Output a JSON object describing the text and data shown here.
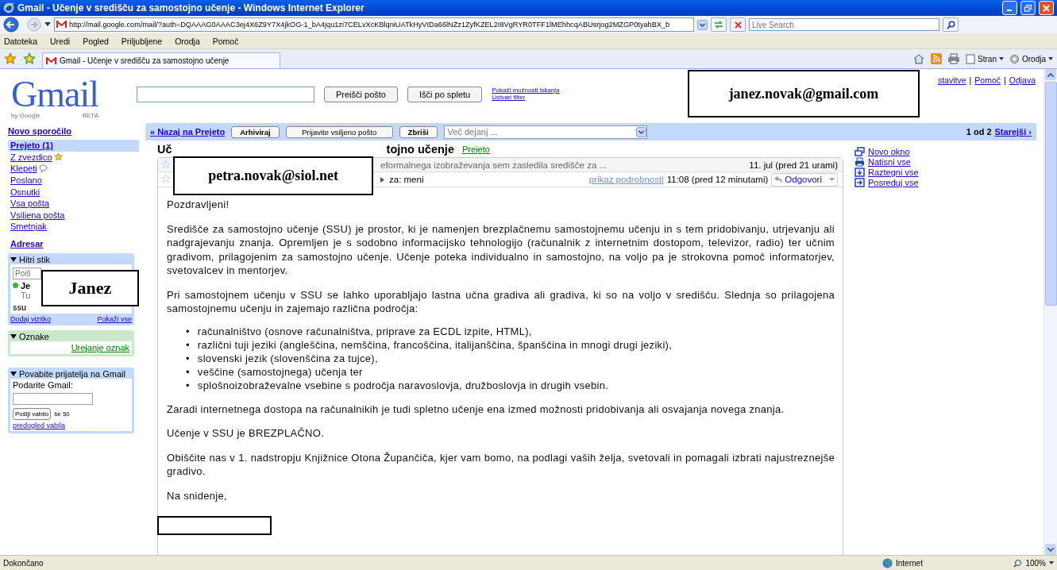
{
  "window": {
    "title": "Gmail - Učenje v središču za samostojno učenje - Windows Internet Explorer"
  },
  "address_bar": {
    "url": "http://mail.google.com/mail/?auth=DQAAAG0AAAC3ej4X6Z9Y7X4jkOG-1_bA4jqu1zi7CELvXcKBlqniUATkHyVIDa66lNZz1ZyfKZEL2I8VgRYR0TFF1lMEhhcqABUsrjog2MZGP0tyahBX_b",
    "search_placeholder": "Live Search"
  },
  "menu": [
    "Datoteka",
    "Uredi",
    "Pogled",
    "Priljubljene",
    "Orodja",
    "Pomoč"
  ],
  "tab": {
    "title": "Gmail - Učenje v središču za samostojno učenje"
  },
  "command_bar": [
    {
      "kind": "page",
      "label": "Stran"
    },
    {
      "kind": "tools",
      "label": "Orodja"
    }
  ],
  "gmail": {
    "logo": {
      "wordmark": "Gmail",
      "byline": "by Google",
      "badge": "BETA"
    },
    "search_buttons": [
      "Preišči pošto",
      "Išči po spletu"
    ],
    "search_links": [
      "Pokaži možnosti iskanja",
      "Ustvari filter"
    ],
    "top_links": [
      {
        "label": "stavitve"
      },
      {
        "separator": "|",
        "label": "Pomoč"
      },
      {
        "separator": "|",
        "label": "Odjava"
      }
    ]
  },
  "sidebar": {
    "compose": "Novo sporočilo",
    "folders": [
      {
        "label": "Prejeto (1)",
        "selected": true
      },
      {
        "label": "Z zvezdico",
        "selected": false,
        "kind": "starred"
      },
      {
        "label": "Klepeti",
        "selected": false,
        "kind": "chats"
      },
      {
        "label": "Poslano",
        "selected": false
      },
      {
        "label": "Osnutki",
        "selected": false
      },
      {
        "label": "Vsa pošta",
        "selected": false
      },
      {
        "label": "Vsiljena pošta",
        "selected": false
      },
      {
        "label": "Smetnjak",
        "selected": false
      }
    ],
    "contacts_link": "Adresar",
    "quick_contacts": {
      "title": "Hitri stik",
      "expanded": true,
      "search_placeholder": "Poiš",
      "contacts": [
        {
          "name": "Je",
          "status": "Tu",
          "online": true
        }
      ],
      "group": "ssu",
      "links": [
        "Dodaj vizitko",
        "Pokaži vse"
      ]
    },
    "labels": {
      "title": "Oznake",
      "expanded": true,
      "link": "Urejanje oznak"
    },
    "invite": {
      "title": "Povabite prijatelja na Gmail",
      "expanded": true,
      "prompt": "Podarite Gmail:",
      "button": "Pošlji vabilo",
      "count": "še 50",
      "link": "predogled vabila"
    }
  },
  "toolbar": {
    "back": "« Nazaj na Prejeto",
    "buttons": [
      "Arhiviraj",
      "Prijavite vsiljeno pošto",
      "Zbriši"
    ],
    "more_actions": "Več dejanj ...",
    "pager": "1 od 2",
    "older": "Starejši ›"
  },
  "conversation": {
    "subject_parts": [
      "Uč",
      "tojno učenje"
    ],
    "label": "Prejeto",
    "messages": [
      {
        "starred": false,
        "snippet": "eformalnega izobraževanja sem zasledila središče za ...",
        "time": "11. jul (pred 21 urami)"
      },
      {
        "starred": false,
        "to": "za: meni",
        "details": "prikaz podrobnosti",
        "time": "11:08 (pred 12 minutami)",
        "reply": "Odgovori"
      }
    ],
    "body": [
      {
        "kind": "para",
        "text": "Pozdravljeni!"
      },
      {
        "kind": "para",
        "text": "Središče za samostojno učenje (SSU) je prostor, ki je namenjen brezplačnemu samostojnemu učenju in s tem pridobivanju, utrjevanju ali nadgrajevanju znanja. Opremljen je s sodobno informacijsko tehnologijo (računalnik z internetnim dostopom, televizor, radio) ter učnim gradivom, prilagojenim za samostojno učenje. Učenje poteka individualno in samostojno, na voljo pa je strokovna pomoč informatorjev, svetovalcev in mentorjev."
      },
      {
        "kind": "para",
        "text": "Pri samostojnem učenju v SSU se lahko uporabljajo lastna učna gradiva ali gradiva, ki so na voljo v središču. Slednja so prilagojena samostojnemu učenju in zajemajo različna področja:"
      },
      {
        "kind": "list",
        "items": [
          {
            "marker": "•",
            "text": "računalništvo (osnove računalništva, priprave za ECDL izpite, HTML),"
          },
          {
            "marker": "•",
            "text": "različni tuji jeziki (angleščina, nemščina, francoščina, italijanščina, španščina in mnogi drugi jeziki),"
          },
          {
            "marker": "•",
            "text": "slovenski jezik  (slovenščina za tujce),"
          },
          {
            "marker": "•",
            "text": "veščine (samostojnega) učenja ter"
          },
          {
            "marker": "•",
            "text": "splošnoizobraževalne vsebine s področja naravoslovja, družboslovja in drugih vsebin."
          }
        ]
      },
      {
        "kind": "para",
        "text": "Zaradi internetnega dostopa na računalnikih je tudi spletno učenje ena izmed možnosti pridobivanja ali osvajanja novega znanja."
      },
      {
        "kind": "para",
        "text": "Učenje v SSU je BREZPLAČNO."
      },
      {
        "kind": "para",
        "text": "Obiščite nas v 1. nadstropju Knjižnice Otona Župančiča, kjer vam bomo, na podlagi vaših želja, svetovali in pomagali izbrati najustreznejše gradivo."
      },
      {
        "kind": "para",
        "text": "Na snidenje,"
      }
    ]
  },
  "actions": [
    {
      "label": "Novo okno",
      "kind": "window"
    },
    {
      "label": "Natisni vse",
      "kind": "print"
    },
    {
      "label": "Raztegni vse",
      "kind": "expand"
    },
    {
      "label": "Posreduj vse",
      "kind": "forward"
    }
  ],
  "redactions": [
    "janez.novak@gmail.com",
    "petra.novak@siol.net",
    "Janez"
  ],
  "status_bar": {
    "text": "Dokončano",
    "zone": "Internet",
    "zoom": "100%"
  }
}
